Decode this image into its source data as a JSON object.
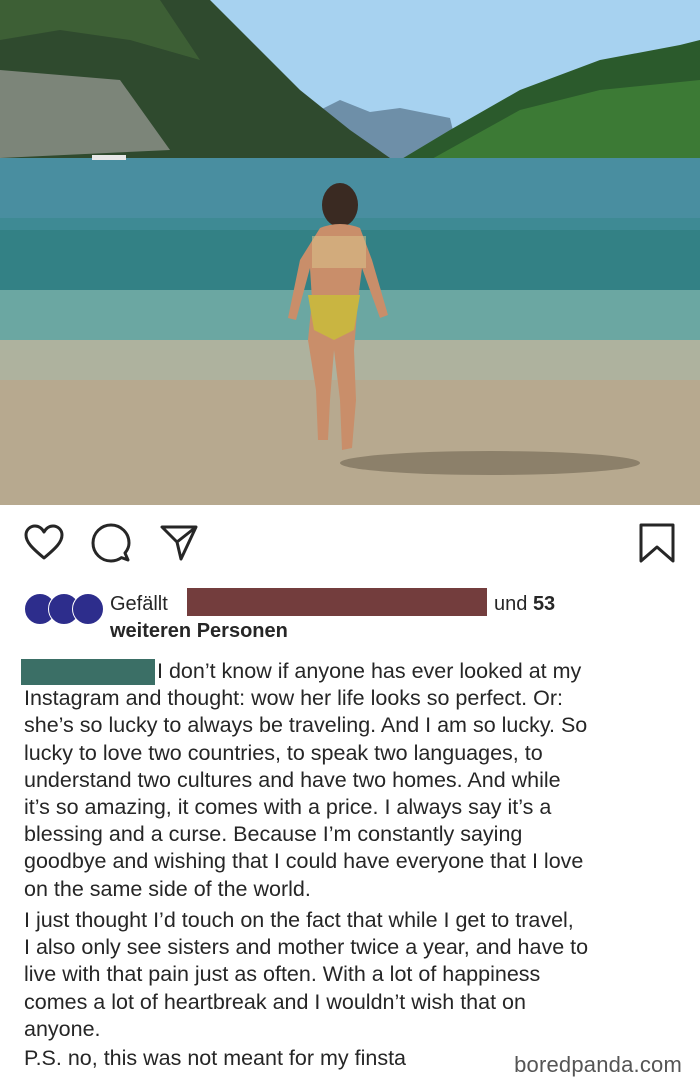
{
  "post": {
    "photo_description_icon": "lake-photo",
    "actions": {
      "like_icon": "heart-icon",
      "comment_icon": "comment-icon",
      "share_icon": "send-icon",
      "save_icon": "bookmark-icon"
    },
    "likes": {
      "prefix": "Gefällt",
      "suffix_word": "und",
      "count": "53",
      "line2": "weiteren Personen"
    },
    "caption": {
      "line1": "I don’t know if anyone has ever looked at my",
      "para1_rest": "Instagram and thought: wow her life looks so perfect. Or:\nshe’s so lucky to always be traveling. And I am so lucky. So\nlucky to love two countries, to speak two languages, to\nunderstand two cultures and have two homes. And while\nit’s so amazing, it comes with a price. I always say it’s a\nblessing and a curse. Because I’m constantly saying\ngoodbye and wishing that I could have everyone that I love\non the same side of the world.",
      "para2": "I just thought I’d touch on the fact that while I get to travel,\nI also only see sisters and mother twice a year, and have to\nlive with that pain just as often.  With a lot of happiness\ncomes a lot of heartbreak and I wouldn’t wish that on\nanyone.",
      "para3": "P.S. no, this was not meant for my finsta"
    }
  },
  "watermark": "boredpanda.com",
  "colors": {
    "redaction_name": "#733d3d",
    "redaction_user": "#3b6f66",
    "avatar": "#2d2d8c"
  }
}
